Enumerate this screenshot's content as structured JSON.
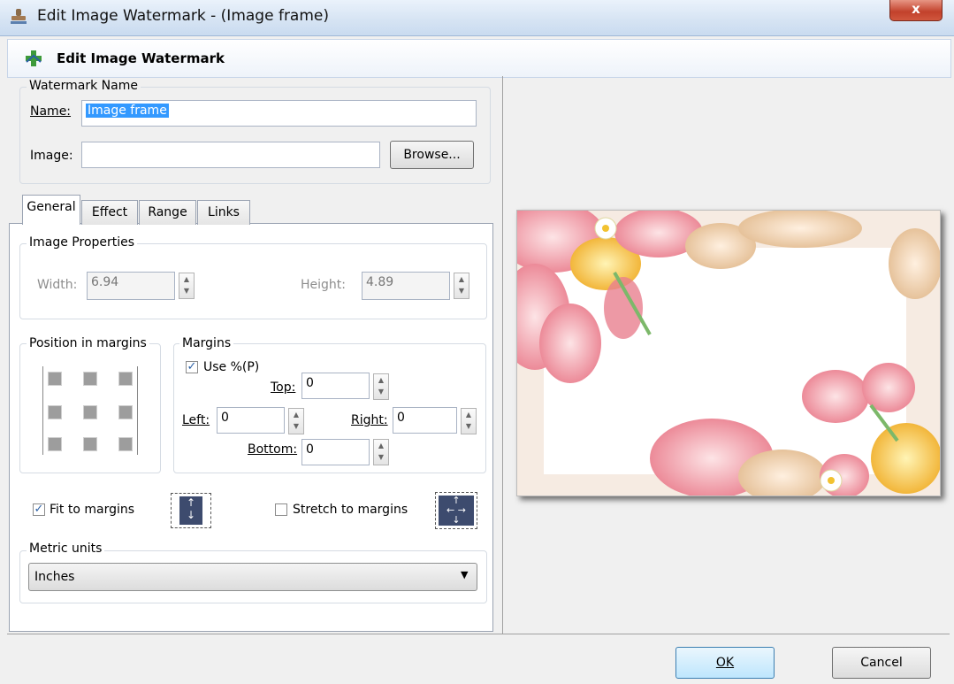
{
  "window": {
    "title": "Edit Image Watermark - (Image frame)",
    "close_label": "x"
  },
  "header": {
    "title": "Edit Image Watermark"
  },
  "watermark_name": {
    "group_label": "Watermark Name",
    "name_label": "Name:",
    "name_value": "Image frame",
    "image_label": "Image:",
    "image_value": "",
    "browse_label": "Browse..."
  },
  "tabs": [
    "General",
    "Effect",
    "Range",
    "Links"
  ],
  "image_properties": {
    "group_label": "Image Properties",
    "width_label": "Width:",
    "width_value": "6.94",
    "height_label": "Height:",
    "height_value": "4.89"
  },
  "position": {
    "group_label": "Position in margins"
  },
  "margins": {
    "group_label": "Margins",
    "use_percent_label": "Use %(P)",
    "use_percent_checked": true,
    "top_label": "Top:",
    "top_value": "0",
    "left_label": "Left:",
    "left_value": "0",
    "right_label": "Right:",
    "right_value": "0",
    "bottom_label": "Bottom:",
    "bottom_value": "0"
  },
  "fit": {
    "label": "Fit to margins",
    "checked": true
  },
  "stretch": {
    "label": "Stretch to margins",
    "checked": false
  },
  "metric": {
    "group_label": "Metric units",
    "selected": "Inches"
  },
  "buttons": {
    "ok": "OK",
    "cancel": "Cancel"
  },
  "colors": {
    "accent": "#2b5fa5",
    "preview_bg": "#fffaf4"
  }
}
